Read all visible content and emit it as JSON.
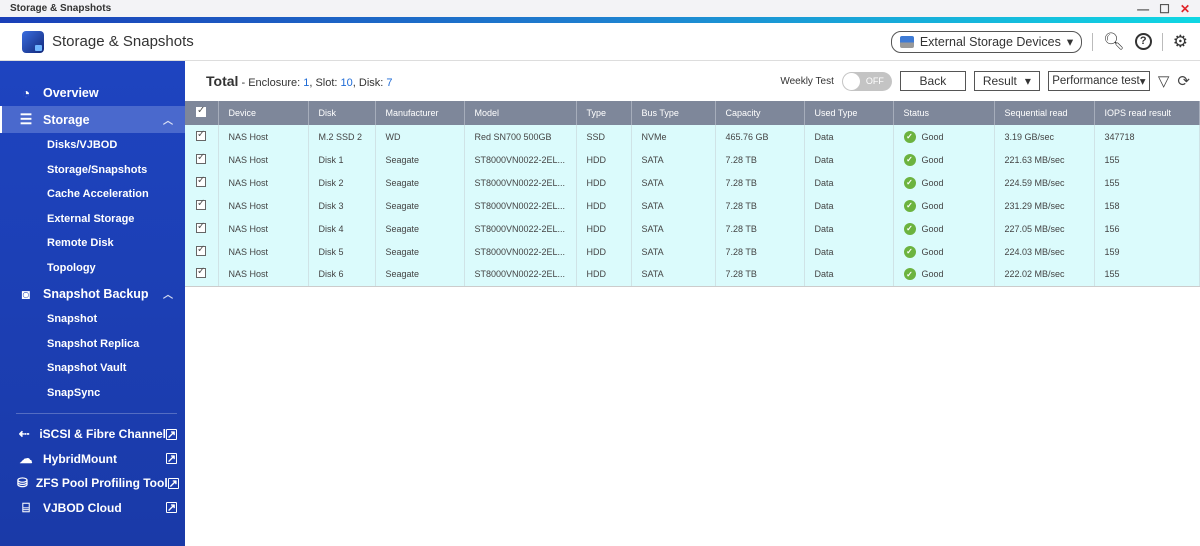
{
  "window": {
    "title": "Storage & Snapshots",
    "minimize": "—",
    "maximize": "☐",
    "close": "✕"
  },
  "header": {
    "app_title": "Storage & Snapshots",
    "external_devices_label": "External Storage Devices",
    "dropdown_caret": "▾"
  },
  "sidebar": {
    "overview": "Overview",
    "storage": {
      "label": "Storage",
      "items": [
        "Disks/VJBOD",
        "Storage/Snapshots",
        "Cache Acceleration",
        "External Storage",
        "Remote Disk",
        "Topology"
      ]
    },
    "snapshot_backup": {
      "label": "Snapshot Backup",
      "items": [
        "Snapshot",
        "Snapshot Replica",
        "Snapshot Vault",
        "SnapSync"
      ]
    },
    "external_apps": [
      "iSCSI & Fibre Channel",
      "HybridMount",
      "ZFS Pool Profiling Tool",
      "VJBOD Cloud"
    ]
  },
  "toolbar": {
    "total_label": "Total",
    "enclosure_label": "- Enclosure: ",
    "enclosure": "1",
    "slot_label": ", Slot: ",
    "slot": "10",
    "disk_label": ", Disk: ",
    "disk": "7",
    "weekly_test_label": "Weekly Test",
    "toggle_state": "OFF",
    "back_label": "Back",
    "result_label": "Result",
    "perf_label": "Performance test"
  },
  "table": {
    "headers": [
      "Device",
      "Disk",
      "Manufacturer",
      "Model",
      "Type",
      "Bus Type",
      "Capacity",
      "Used Type",
      "Status",
      "Sequential read",
      "IOPS read result"
    ],
    "rows": [
      [
        "NAS Host",
        "M.2 SSD 2",
        "WD",
        "Red SN700 500GB",
        "SSD",
        "NVMe",
        "465.76 GB",
        "Data",
        "Good",
        "3.19 GB/sec",
        "347718"
      ],
      [
        "NAS Host",
        "Disk 1",
        "Seagate",
        "ST8000VN0022-2EL...",
        "HDD",
        "SATA",
        "7.28 TB",
        "Data",
        "Good",
        "221.63 MB/sec",
        "155"
      ],
      [
        "NAS Host",
        "Disk 2",
        "Seagate",
        "ST8000VN0022-2EL...",
        "HDD",
        "SATA",
        "7.28 TB",
        "Data",
        "Good",
        "224.59 MB/sec",
        "155"
      ],
      [
        "NAS Host",
        "Disk 3",
        "Seagate",
        "ST8000VN0022-2EL...",
        "HDD",
        "SATA",
        "7.28 TB",
        "Data",
        "Good",
        "231.29 MB/sec",
        "158"
      ],
      [
        "NAS Host",
        "Disk 4",
        "Seagate",
        "ST8000VN0022-2EL...",
        "HDD",
        "SATA",
        "7.28 TB",
        "Data",
        "Good",
        "227.05 MB/sec",
        "156"
      ],
      [
        "NAS Host",
        "Disk 5",
        "Seagate",
        "ST8000VN0022-2EL...",
        "HDD",
        "SATA",
        "7.28 TB",
        "Data",
        "Good",
        "224.03 MB/sec",
        "159"
      ],
      [
        "NAS Host",
        "Disk 6",
        "Seagate",
        "ST8000VN0022-2EL...",
        "HDD",
        "SATA",
        "7.28 TB",
        "Data",
        "Good",
        "222.02 MB/sec",
        "155"
      ]
    ]
  },
  "colors": {
    "sidebar": "#1e44c0",
    "header_row": "#7e879a",
    "row_bg": "#dbfbfc",
    "good": "#6cb33f",
    "accent_num": "#1e6bd6"
  }
}
